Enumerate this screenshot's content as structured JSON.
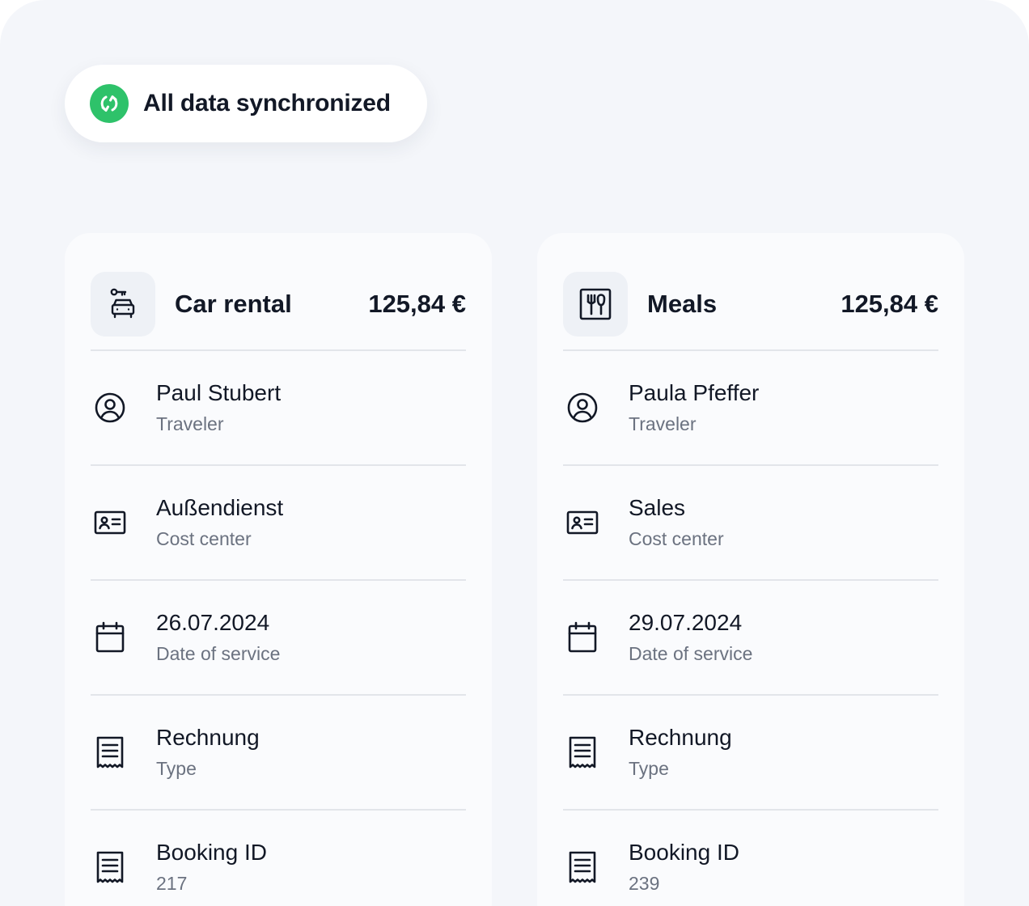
{
  "sync_status": {
    "text": "All data synchronized",
    "icon": "sync-icon",
    "color": "#2ec26a"
  },
  "cards": [
    {
      "category": "Car rental",
      "category_icon": "car-rental-icon",
      "amount": "125,84 €",
      "rows": [
        {
          "icon": "user-circle-icon",
          "value": "Paul Stubert",
          "label": "Traveler"
        },
        {
          "icon": "id-card-icon",
          "value": "Außendienst",
          "label": "Cost center"
        },
        {
          "icon": "calendar-icon",
          "value": "26.07.2024",
          "label": "Date of service"
        },
        {
          "icon": "receipt-icon",
          "value": "Rechnung",
          "label": "Type"
        },
        {
          "icon": "receipt-icon",
          "value": "Booking ID",
          "label": "217"
        }
      ]
    },
    {
      "category": "Meals",
      "category_icon": "meals-icon",
      "amount": "125,84 €",
      "rows": [
        {
          "icon": "user-circle-icon",
          "value": "Paula Pfeffer",
          "label": "Traveler"
        },
        {
          "icon": "id-card-icon",
          "value": "Sales",
          "label": "Cost center"
        },
        {
          "icon": "calendar-icon",
          "value": "29.07.2024",
          "label": "Date of service"
        },
        {
          "icon": "receipt-icon",
          "value": "Rechnung",
          "label": "Type"
        },
        {
          "icon": "receipt-icon",
          "value": "Booking ID",
          "label": "239"
        }
      ]
    }
  ]
}
